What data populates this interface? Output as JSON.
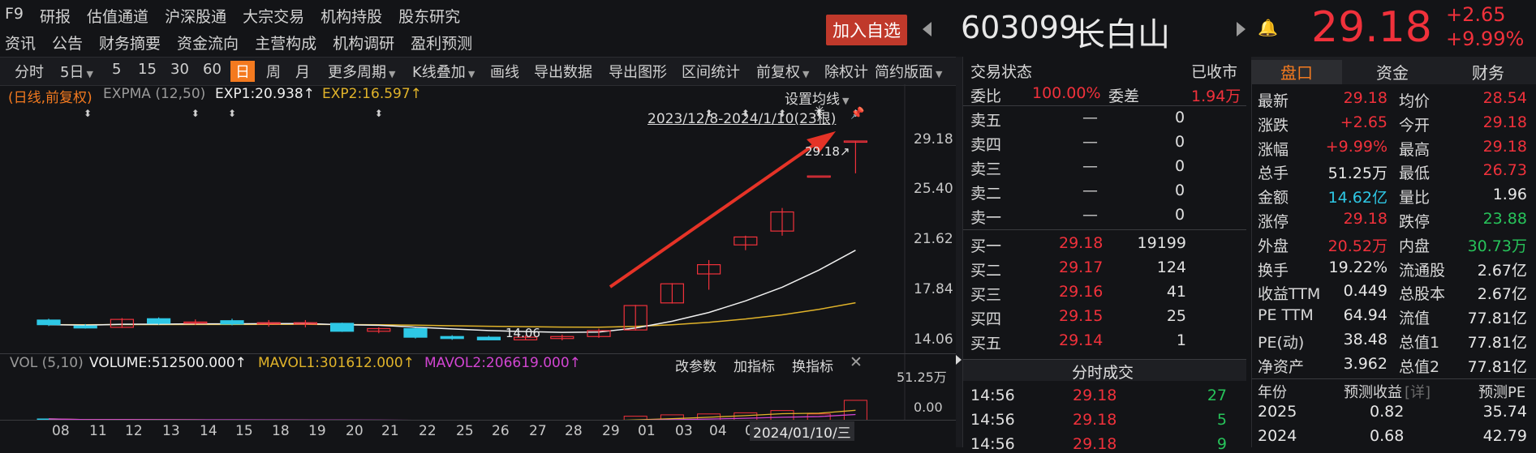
{
  "menu": {
    "row1": [
      "F9",
      "研报",
      "估值通道",
      "沪深股通",
      "大宗交易",
      "机构持股",
      "股东研究"
    ],
    "row2": [
      "资讯",
      "公告",
      "财务摘要",
      "资金流向",
      "主营构成",
      "机构调研",
      "盈利预测"
    ]
  },
  "header": {
    "add_fav": "加入自选",
    "code": "603099",
    "name": "长白山",
    "price": "29.18",
    "change": "+2.65",
    "change_pct": "+9.99%"
  },
  "toolbar": {
    "items": [
      "分时",
      "5日",
      "5",
      "15",
      "30",
      "60",
      "日",
      "周",
      "月",
      "更多周期",
      "K线叠加",
      "画线",
      "导出数据",
      "导出图形",
      "区间统计",
      "前复权",
      "除权计",
      "简约版面"
    ],
    "active": "日"
  },
  "kline": {
    "legend_mode": "(日线,前复权)",
    "legend_ind": "EXPMA (12,50)",
    "exp1": "EXP1:20.938↑",
    "exp2": "EXP2:16.597↑",
    "set_ma": "设置均线",
    "range_label": "2023/12/8-2024/1/10(23根)",
    "max_label": "29.18↗",
    "min_label": "14.06",
    "yticks": [
      "29.18",
      "25.40",
      "21.62",
      "17.84",
      "14.06"
    ]
  },
  "vol": {
    "label": "VOL (5,10)",
    "volume": "VOLUME:512500.000↑",
    "mavol1": "MAVOL1:301612.000↑",
    "mavol2": "MAVOL2:206619.000↑",
    "btn_params": "改参数",
    "btn_add": "加指标",
    "btn_switch": "换指标",
    "yticks": [
      "51.25万",
      "0.00"
    ]
  },
  "xaxis": {
    "labels": [
      "08",
      "11",
      "12",
      "13",
      "14",
      "15",
      "18",
      "19",
      "20",
      "21",
      "22",
      "25",
      "26",
      "27",
      "28",
      "29",
      "01",
      "03",
      "04",
      "05"
    ],
    "cursor_date": "2024/01/10/三"
  },
  "chart_data": {
    "type": "candlestick",
    "dates": [
      "2023/12/08",
      "12/11",
      "12/12",
      "12/13",
      "12/14",
      "12/15",
      "12/18",
      "12/19",
      "12/20",
      "12/21",
      "12/22",
      "12/25",
      "12/26",
      "12/27",
      "12/28",
      "12/29",
      "2024/01/02",
      "01/03",
      "01/04",
      "01/05",
      "01/08",
      "01/09",
      "01/10"
    ],
    "candles": [
      {
        "o": 15.6,
        "c": 15.25,
        "h": 15.7,
        "l": 15.15
      },
      {
        "o": 15.15,
        "c": 15.0,
        "h": 15.3,
        "l": 14.95
      },
      {
        "o": 15.05,
        "c": 15.65,
        "h": 15.75,
        "l": 15.0
      },
      {
        "o": 15.7,
        "c": 15.35,
        "h": 15.8,
        "l": 15.25
      },
      {
        "o": 15.45,
        "c": 15.45,
        "h": 15.65,
        "l": 15.25
      },
      {
        "o": 15.55,
        "c": 15.3,
        "h": 15.7,
        "l": 15.2
      },
      {
        "o": 15.4,
        "c": 15.4,
        "h": 15.6,
        "l": 15.1
      },
      {
        "o": 15.3,
        "c": 15.4,
        "h": 15.6,
        "l": 15.05
      },
      {
        "o": 15.35,
        "c": 14.75,
        "h": 15.4,
        "l": 14.7
      },
      {
        "o": 14.75,
        "c": 14.95,
        "h": 15.05,
        "l": 14.6
      },
      {
        "o": 14.95,
        "c": 14.3,
        "h": 15.0,
        "l": 14.2
      },
      {
        "o": 14.35,
        "c": 14.2,
        "h": 14.45,
        "l": 14.1
      },
      {
        "o": 14.3,
        "c": 14.1,
        "h": 14.4,
        "l": 14.06
      },
      {
        "o": 14.1,
        "c": 14.3,
        "h": 14.45,
        "l": 14.06
      },
      {
        "o": 14.2,
        "c": 14.35,
        "h": 14.5,
        "l": 14.06
      },
      {
        "o": 14.35,
        "c": 14.8,
        "h": 14.95,
        "l": 14.25
      },
      {
        "o": 14.85,
        "c": 16.7,
        "h": 16.75,
        "l": 14.8
      },
      {
        "o": 16.9,
        "c": 18.35,
        "h": 18.4,
        "l": 16.85
      },
      {
        "o": 19.1,
        "c": 19.8,
        "h": 20.15,
        "l": 17.9
      },
      {
        "o": 21.3,
        "c": 21.9,
        "h": 22.0,
        "l": 20.9
      },
      {
        "o": 22.35,
        "c": 23.8,
        "h": 24.1,
        "l": 22.0
      },
      {
        "o": 26.53,
        "c": 26.53,
        "h": 26.53,
        "l": 26.53
      },
      {
        "o": 29.18,
        "c": 29.18,
        "h": 29.18,
        "l": 26.73
      }
    ],
    "exp1_end": 20.938,
    "exp2_end": 16.597,
    "ylim": [
      14.06,
      29.18
    ],
    "volume_max": 512500
  },
  "order_book": {
    "title": "交易状态",
    "status": "已收市",
    "wb_label": "委比",
    "wb": "100.00%",
    "wc_label": "委差",
    "wc": "1.94万",
    "sells": [
      {
        "label": "卖五",
        "price": "—",
        "vol": "0"
      },
      {
        "label": "卖四",
        "price": "—",
        "vol": "0"
      },
      {
        "label": "卖三",
        "price": "—",
        "vol": "0"
      },
      {
        "label": "卖二",
        "price": "—",
        "vol": "0"
      },
      {
        "label": "卖一",
        "price": "—",
        "vol": "0"
      }
    ],
    "buys": [
      {
        "label": "买一",
        "price": "29.18",
        "vol": "19199"
      },
      {
        "label": "买二",
        "price": "29.17",
        "vol": "124"
      },
      {
        "label": "买三",
        "price": "29.16",
        "vol": "41"
      },
      {
        "label": "买四",
        "price": "29.15",
        "vol": "25"
      },
      {
        "label": "买五",
        "price": "29.14",
        "vol": "1"
      }
    ],
    "ticks_title": "分时成交",
    "ticks": [
      {
        "time": "14:56",
        "price": "29.18",
        "vol": "27"
      },
      {
        "time": "14:56",
        "price": "29.18",
        "vol": "5"
      },
      {
        "time": "14:56",
        "price": "29.18",
        "vol": "9"
      }
    ]
  },
  "quote": {
    "tabs": [
      "盘口",
      "资金",
      "财务"
    ],
    "rows": [
      {
        "l1": "最新",
        "v1": "29.18",
        "c1": "red",
        "l2": "均价",
        "v2": "28.54",
        "c2": "red"
      },
      {
        "l1": "涨跌",
        "v1": "+2.65",
        "c1": "red",
        "l2": "今开",
        "v2": "29.18",
        "c2": "red"
      },
      {
        "l1": "涨幅",
        "v1": "+9.99%",
        "c1": "red",
        "l2": "最高",
        "v2": "29.18",
        "c2": "red"
      },
      {
        "l1": "总手",
        "v1": "51.25万",
        "c1": "white",
        "l2": "最低",
        "v2": "26.73",
        "c2": "red"
      },
      {
        "l1": "金额",
        "v1": "14.62亿",
        "c1": "cyan",
        "l2": "量比",
        "v2": "1.96",
        "c2": "white"
      },
      {
        "l1": "涨停",
        "v1": "29.18",
        "c1": "red",
        "l2": "跌停",
        "v2": "23.88",
        "c2": "green"
      },
      {
        "l1": "外盘",
        "v1": "20.52万",
        "c1": "red",
        "l2": "内盘",
        "v2": "30.73万",
        "c2": "green"
      },
      {
        "l1": "换手",
        "v1": "19.22%",
        "c1": "white",
        "l2": "流通股",
        "v2": "2.67亿",
        "c2": "white"
      },
      {
        "l1": "收益TTM",
        "v1": "0.449",
        "c1": "white",
        "l2": "总股本",
        "v2": "2.67亿",
        "c2": "white"
      },
      {
        "l1": "PE TTM",
        "v1": "64.94",
        "c1": "white",
        "l2": "流值",
        "v2": "77.81亿",
        "c2": "white"
      },
      {
        "l1": "PE(动)",
        "v1": "38.48",
        "c1": "white",
        "l2": "总值1",
        "v2": "77.81亿",
        "c2": "white"
      },
      {
        "l1": "净资产",
        "v1": "3.962",
        "c1": "white",
        "l2": "总值2",
        "v2": "77.81亿",
        "c2": "white"
      }
    ],
    "forecast_head": {
      "year": "年份",
      "eps": "预测收益",
      "detail": "[详]",
      "pe": "预测PE"
    },
    "forecast": [
      {
        "year": "2025",
        "eps": "0.82",
        "pe": "35.74"
      },
      {
        "year": "2024",
        "eps": "0.68",
        "pe": "42.79"
      }
    ]
  }
}
